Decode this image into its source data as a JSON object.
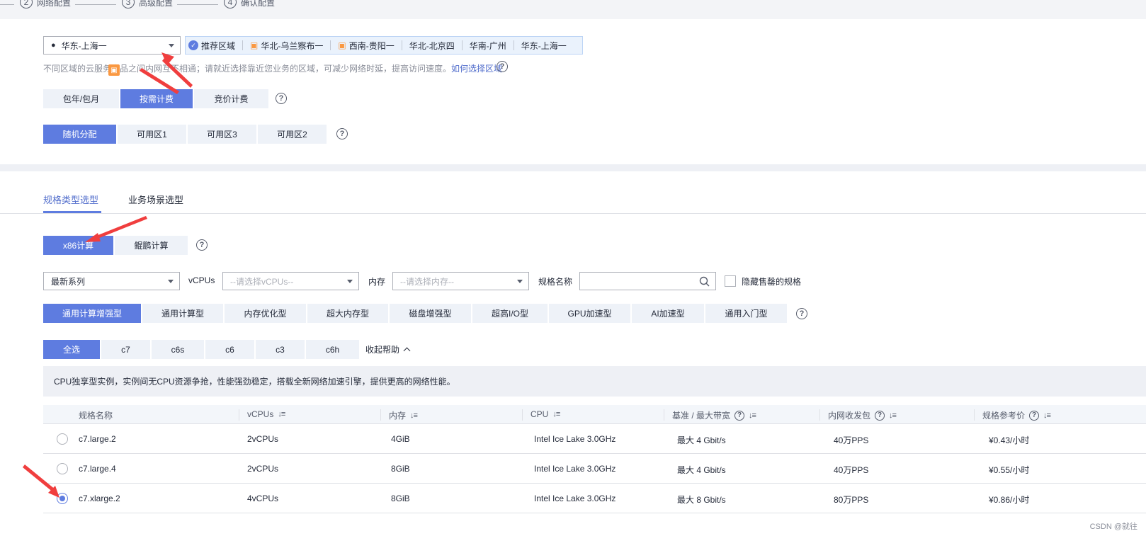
{
  "steps": [
    {
      "num": "2",
      "label": "网络配置"
    },
    {
      "num": "3",
      "label": "高级配置"
    },
    {
      "num": "4",
      "label": "确认配置"
    }
  ],
  "region": {
    "selected": "华东-上海一",
    "recommend_label": "推荐区域",
    "tags": [
      "华北-乌兰察布一",
      "西南-贵阳一",
      "华北-北京四",
      "华南-广州",
      "华东-上海一"
    ],
    "hint_text": "不同区域的云服务产品之间内网互不相通；请就近选择靠近您业务的区域，可减少网络时延，提高访问速度。",
    "hint_link": "如何选择区域"
  },
  "billing": {
    "options": [
      "包年/包月",
      "按需计费",
      "竞价计费"
    ],
    "selected_index": 1
  },
  "az": {
    "options": [
      "随机分配",
      "可用区1",
      "可用区3",
      "可用区2"
    ],
    "selected_index": 0
  },
  "spec_tabs": [
    "规格类型选型",
    "业务场景选型"
  ],
  "arch": {
    "options": [
      "x86计算",
      "鲲鹏计算"
    ],
    "selected_index": 0
  },
  "filters": {
    "series": "最新系列",
    "vcpus_label": "vCPUs",
    "vcpus_placeholder": "--请选择vCPUs--",
    "mem_label": "内存",
    "mem_placeholder": "--请选择内存--",
    "name_label": "规格名称",
    "hide_soldout": "隐藏售罄的规格"
  },
  "types": {
    "options": [
      "通用计算增强型",
      "通用计算型",
      "内存优化型",
      "超大内存型",
      "磁盘增强型",
      "超高I/O型",
      "GPU加速型",
      "AI加速型",
      "通用入门型"
    ],
    "selected_index": 0
  },
  "families": {
    "options": [
      "全选",
      "c7",
      "c6s",
      "c6",
      "c3",
      "c6h"
    ],
    "selected_index": 0,
    "collapse_help": "收起帮助"
  },
  "help_text": "CPU独享型实例，实例间无CPU资源争抢，性能强劲稳定，搭载全新网络加速引擎，提供更高的网络性能。",
  "table": {
    "headers": [
      "规格名称",
      "vCPUs",
      "内存",
      "CPU",
      "基准 / 最大带宽",
      "内网收发包",
      "规格参考价"
    ],
    "rows": [
      {
        "name": "c7.large.2",
        "vcpus": "2vCPUs",
        "mem": "4GiB",
        "cpu": "Intel Ice Lake 3.0GHz",
        "bw": "最大 4 Gbit/s",
        "pps": "40万PPS",
        "price": "¥0.43/小时",
        "selected": false
      },
      {
        "name": "c7.large.4",
        "vcpus": "2vCPUs",
        "mem": "8GiB",
        "cpu": "Intel Ice Lake 3.0GHz",
        "bw": "最大 4 Gbit/s",
        "pps": "40万PPS",
        "price": "¥0.55/小时",
        "selected": false
      },
      {
        "name": "c7.xlarge.2",
        "vcpus": "4vCPUs",
        "mem": "8GiB",
        "cpu": "Intel Ice Lake 3.0GHz",
        "bw": "最大 8 Gbit/s",
        "pps": "80万PPS",
        "price": "¥0.86/小时",
        "selected": true
      }
    ]
  },
  "watermark": "CSDN @就往",
  "colors": {
    "accent": "#5e7ce0",
    "annotation": "#f03e3e"
  }
}
